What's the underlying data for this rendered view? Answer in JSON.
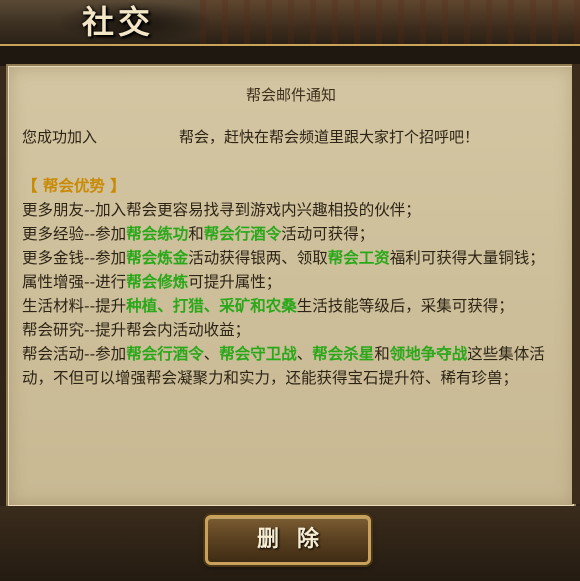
{
  "header": {
    "title": "社交"
  },
  "mail": {
    "title": "帮会邮件通知",
    "intro_prefix": "您成功加入",
    "intro_suffix": "帮会，赶快在帮会频道里跟大家打个招呼吧！",
    "section_heading": "【 帮会优势 】",
    "lines": [
      [
        {
          "text": "更多朋友--加入帮会更容易找寻到游戏内兴趣相投的伙伴；",
          "hl": false
        }
      ],
      [
        {
          "text": "更多经验--参加",
          "hl": false
        },
        {
          "text": "帮会练功",
          "hl": true
        },
        {
          "text": "和",
          "hl": false
        },
        {
          "text": "帮会行酒令",
          "hl": true
        },
        {
          "text": "活动可获得；",
          "hl": false
        }
      ],
      [
        {
          "text": "更多金钱--参加",
          "hl": false
        },
        {
          "text": "帮会炼金",
          "hl": true
        },
        {
          "text": "活动获得银两、领取",
          "hl": false
        },
        {
          "text": "帮会工资",
          "hl": true
        },
        {
          "text": "福利可获得大量铜钱；",
          "hl": false
        }
      ],
      [
        {
          "text": "属性增强--进行",
          "hl": false
        },
        {
          "text": "帮会修炼",
          "hl": true
        },
        {
          "text": "可提升属性；",
          "hl": false
        }
      ],
      [
        {
          "text": "生活材料--提升",
          "hl": false
        },
        {
          "text": "种植、打猎、采矿和农桑",
          "hl": true
        },
        {
          "text": "生活技能等级后，采集可获得；",
          "hl": false
        }
      ],
      [
        {
          "text": "帮会研究--提升帮会内活动收益；",
          "hl": false
        }
      ],
      [
        {
          "text": "帮会活动--参加",
          "hl": false
        },
        {
          "text": "帮会行酒令",
          "hl": true
        },
        {
          "text": "、",
          "hl": false
        },
        {
          "text": "帮会守卫战",
          "hl": true
        },
        {
          "text": "、",
          "hl": false
        },
        {
          "text": "帮会杀星",
          "hl": true
        },
        {
          "text": "和",
          "hl": false
        },
        {
          "text": "领地争夺战",
          "hl": true
        },
        {
          "text": "这些集体活动，不但可以增强帮会凝聚力和实力，还能获得宝石提升符、稀有珍兽；",
          "hl": false
        }
      ]
    ]
  },
  "footer": {
    "delete_label": "删除"
  },
  "colors": {
    "highlight": "#2aa81a",
    "heading": "#c98a05"
  }
}
